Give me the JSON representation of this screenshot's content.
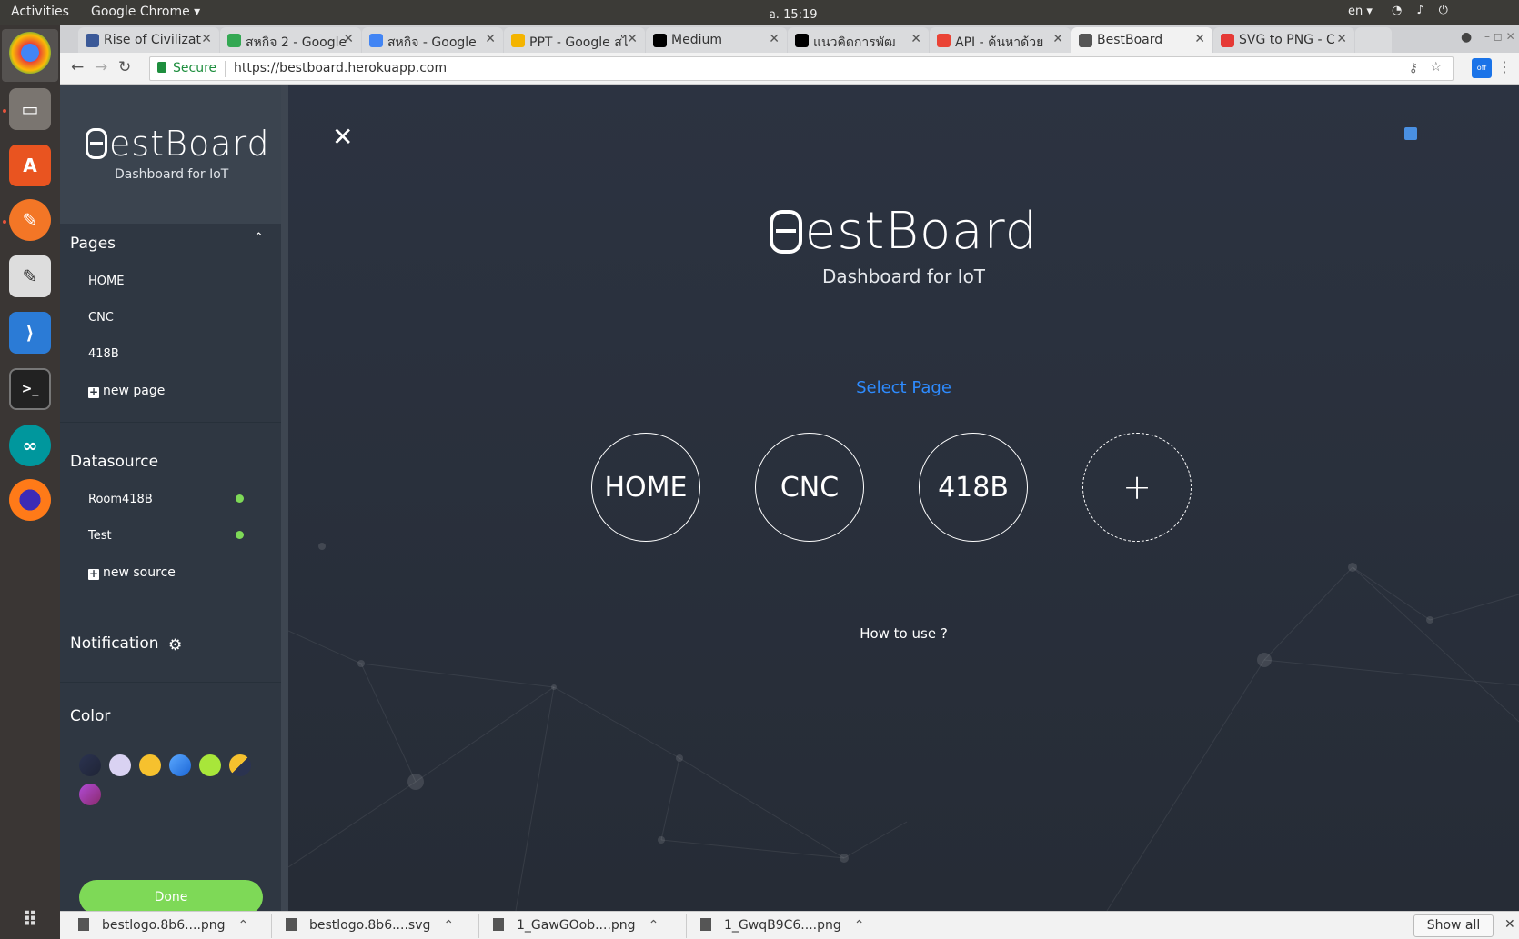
{
  "topbar": {
    "activities": "Activities",
    "app_name": "Google Chrome ▾",
    "clock": "อ. 15:19",
    "lang": "en ▾"
  },
  "tabs": [
    {
      "title": "Rise of Civilizat",
      "favicon_color": "#3b5998"
    },
    {
      "title": "สหกิจ 2 - Google",
      "favicon_color": "#34a853"
    },
    {
      "title": "สหกิจ - Google",
      "favicon_color": "#4285f4"
    },
    {
      "title": "PPT - Google สไ",
      "favicon_color": "#f4b400"
    },
    {
      "title": "Medium",
      "favicon_color": "#000000"
    },
    {
      "title": "แนวคิดการพัฒ",
      "favicon_color": "#000000"
    },
    {
      "title": "API - ค้นหาด้วย",
      "favicon_color": "#ea4335"
    },
    {
      "title": "BestBoard",
      "favicon_color": "#555555"
    },
    {
      "title": "SVG to PNG - C",
      "favicon_color": "#e53935"
    }
  ],
  "address": {
    "secure_label": "Secure",
    "url": "https://bestboard.herokuapp.com"
  },
  "sidebar": {
    "brand_name": "estBoard",
    "brand_tagline": "Dashboard for IoT",
    "pages_title": "Pages",
    "pages": [
      "HOME",
      "CNC",
      "418B"
    ],
    "new_page": "new page",
    "datasource_title": "Datasource",
    "sources": [
      {
        "name": "Room418B",
        "status_color": "#7ed957"
      },
      {
        "name": "Test",
        "status_color": "#7ed957"
      }
    ],
    "new_source": "new source",
    "notification_title": "Notification",
    "color_title": "Color",
    "done_label": "Done"
  },
  "main": {
    "logo_name": "estBoard",
    "logo_tagline": "Dashboard for IoT",
    "select_title": "Select Page",
    "page_buttons": [
      "HOME",
      "CNC",
      "418B"
    ],
    "add_symbol": "+",
    "how_to_use": "How to use ?"
  },
  "downloads": {
    "items": [
      "bestlogo.8b6....png",
      "bestlogo.8b6....svg",
      "1_GawGOob....png",
      "1_GwqB9C6....png"
    ],
    "show_all": "Show all"
  },
  "colors": {
    "accent_blue": "#2e8bff",
    "done_green": "#7ed957",
    "sidebar_bg": "#2f3742",
    "main_bg": "#2c3341"
  }
}
